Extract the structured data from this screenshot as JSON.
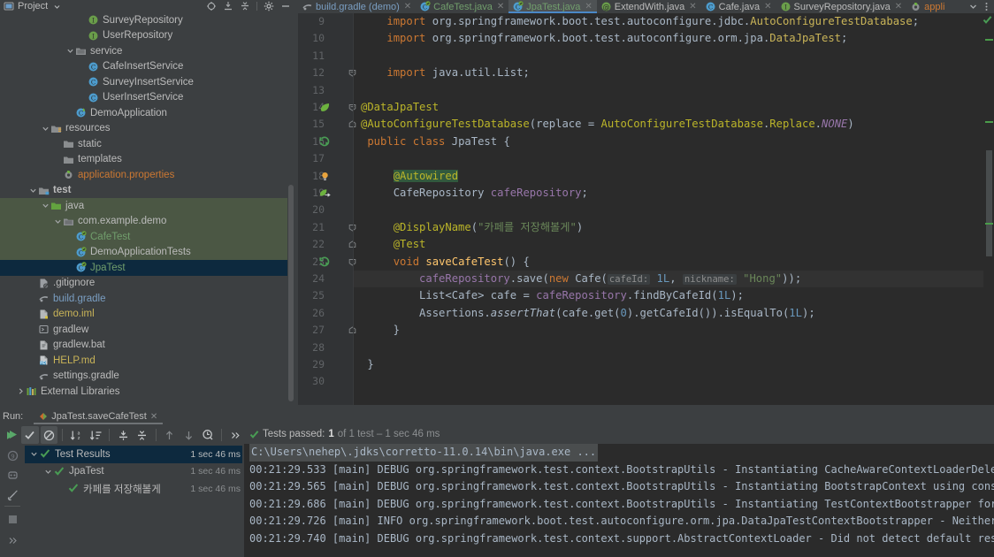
{
  "project_panel": {
    "title": "Project",
    "title_icon": "project-icon",
    "dropdown_icon": "chevron-down-icon",
    "toolbar": [
      {
        "name": "locate-icon",
        "label": ""
      },
      {
        "name": "expand-all-icon",
        "label": ""
      },
      {
        "name": "collapse-all-icon",
        "label": ""
      },
      {
        "name": "gear-icon",
        "label": ""
      },
      {
        "name": "hide-icon",
        "label": ""
      }
    ],
    "tree": [
      {
        "label": "SurveyRepository",
        "icon": "interface-icon",
        "indent": 6,
        "arrow": "",
        "color": "#bbbbbb",
        "section": "none"
      },
      {
        "label": "UserRepository",
        "icon": "interface-icon",
        "indent": 6,
        "arrow": "",
        "color": "#bbbbbb",
        "section": "none"
      },
      {
        "label": "service",
        "icon": "package-icon",
        "indent": 5,
        "arrow": "down",
        "color": "#bbbbbb",
        "section": "none"
      },
      {
        "label": "CafeInsertService",
        "icon": "class-icon",
        "indent": 6,
        "arrow": "",
        "color": "#bbbbbb",
        "section": "none"
      },
      {
        "label": "SurveyInsertService",
        "icon": "class-icon",
        "indent": 6,
        "arrow": "",
        "color": "#bbbbbb",
        "section": "none"
      },
      {
        "label": "UserInsertService",
        "icon": "class-icon",
        "indent": 6,
        "arrow": "",
        "color": "#bbbbbb",
        "section": "none"
      },
      {
        "label": "DemoApplication",
        "icon": "spring-class-icon",
        "indent": 5,
        "arrow": "",
        "color": "#bbbbbb",
        "section": "none"
      },
      {
        "label": "resources",
        "icon": "resources-root-icon",
        "indent": 3,
        "arrow": "down",
        "color": "#bbbbbb",
        "section": "none"
      },
      {
        "label": "static",
        "icon": "folder-icon",
        "indent": 4,
        "arrow": "",
        "color": "#bbbbbb",
        "section": "none"
      },
      {
        "label": "templates",
        "icon": "folder-icon",
        "indent": 4,
        "arrow": "",
        "color": "#bbbbbb",
        "section": "none"
      },
      {
        "label": "application.properties",
        "icon": "spring-properties-icon",
        "indent": 4,
        "arrow": "",
        "color": "#cc7832",
        "section": "none"
      },
      {
        "label": "test",
        "icon": "test-root-icon",
        "indent": 2,
        "arrow": "down",
        "color": "#bbbbbb",
        "bold": true,
        "section": "none"
      },
      {
        "label": "java",
        "icon": "test-source-icon",
        "indent": 3,
        "arrow": "down",
        "color": "#bbbbbb",
        "section": "test"
      },
      {
        "label": "com.example.demo",
        "icon": "package-icon",
        "indent": 4,
        "arrow": "down",
        "color": "#bbbbbb",
        "section": "test"
      },
      {
        "label": "CafeTest",
        "icon": "test-class-icon",
        "indent": 5,
        "arrow": "",
        "color": "#719e6c",
        "section": "test"
      },
      {
        "label": "DemoApplicationTests",
        "icon": "test-class-icon",
        "indent": 5,
        "arrow": "",
        "color": "#bbbbbb",
        "section": "test"
      },
      {
        "label": "JpaTest",
        "icon": "test-class-icon",
        "indent": 5,
        "arrow": "",
        "color": "#719e6c",
        "section": "selected"
      },
      {
        "label": ".gitignore",
        "icon": "gitignore-icon",
        "indent": 2,
        "arrow": "",
        "color": "#bbbbbb",
        "section": "none"
      },
      {
        "label": "build.gradle",
        "icon": "gradle-icon",
        "indent": 2,
        "arrow": "",
        "color": "#7a9ec2",
        "section": "none"
      },
      {
        "label": "demo.iml",
        "icon": "iml-icon",
        "indent": 2,
        "arrow": "",
        "color": "#c9b458",
        "section": "none"
      },
      {
        "label": "gradlew",
        "icon": "script-icon",
        "indent": 2,
        "arrow": "",
        "color": "#bbbbbb",
        "section": "none"
      },
      {
        "label": "gradlew.bat",
        "icon": "bat-icon",
        "indent": 2,
        "arrow": "",
        "color": "#bbbbbb",
        "section": "none"
      },
      {
        "label": "HELP.md",
        "icon": "markdown-icon",
        "indent": 2,
        "arrow": "",
        "color": "#c9b458",
        "section": "none"
      },
      {
        "label": "settings.gradle",
        "icon": "gradle-icon",
        "indent": 2,
        "arrow": "",
        "color": "#bbbbbb",
        "section": "none"
      },
      {
        "label": "External Libraries",
        "icon": "libraries-icon",
        "indent": 1,
        "arrow": "right",
        "color": "#bbbbbb",
        "section": "none"
      }
    ]
  },
  "editor": {
    "tabs": [
      {
        "label": "build.gradle (demo)",
        "icon": "gradle-icon",
        "active": false,
        "color": "#7a9ec2",
        "closable": true
      },
      {
        "label": "CafeTest.java",
        "icon": "test-class-icon",
        "active": false,
        "color": "#719e6c",
        "closable": true
      },
      {
        "label": "JpaTest.java",
        "icon": "test-class-icon",
        "active": true,
        "color": "#719e6c",
        "closable": true
      },
      {
        "label": "ExtendWith.java",
        "icon": "annotation-icon",
        "active": false,
        "color": "#bbbbbb",
        "closable": true
      },
      {
        "label": "Cafe.java",
        "icon": "class-icon",
        "active": false,
        "color": "#bbbbbb",
        "closable": true
      },
      {
        "label": "SurveyRepository.java",
        "icon": "interface-icon",
        "active": false,
        "color": "#bbbbbb",
        "closable": true
      },
      {
        "label": "appli",
        "icon": "spring-properties-icon",
        "active": false,
        "color": "#cc7832",
        "closable": false
      }
    ],
    "tabbar_right": [
      {
        "name": "tab-list-chevron-icon"
      },
      {
        "name": "more-options-icon"
      }
    ],
    "first_line_number": 9,
    "last_line_number": 30,
    "caret_line": 24,
    "status_ok_icon": "inspection-ok-icon",
    "lines": [
      {
        "n": 9,
        "gutter": "",
        "fold": "",
        "html": "    <span class=\"kw\">import</span> org.springframework.boot.test.autoconfigure.jdbc.<span style=\"color:#c9b458\">AutoConfigureTestDatabase</span>;"
      },
      {
        "n": 10,
        "gutter": "",
        "fold": "",
        "html": "    <span class=\"kw\">import</span> org.springframework.boot.test.autoconfigure.orm.jpa.<span style=\"color:#c9b458\">DataJpaTest</span>;"
      },
      {
        "n": 11,
        "gutter": "",
        "fold": "",
        "html": ""
      },
      {
        "n": 12,
        "gutter": "",
        "fold": "collapse",
        "html": "    <span class=\"kw\">import</span> java.util.List;"
      },
      {
        "n": 13,
        "gutter": "",
        "fold": "",
        "html": ""
      },
      {
        "n": 14,
        "gutter": "spring-leaf-icon",
        "fold": "collapse",
        "html": "<span class=\"ann\">@DataJpaTest</span>"
      },
      {
        "n": 15,
        "gutter": "",
        "fold": "fold-mid",
        "html": "<span class=\"ann\">@AutoConfigureTestDatabase</span>(<span class=\"typ\">replace</span> = <span class=\"ann\">AutoConfigureTestDatabase</span>.<span class=\"ann\">Replace</span>.<span class=\"cst\">NONE</span>)"
      },
      {
        "n": 16,
        "gutter": "run-test-icon",
        "fold": "",
        "html": " <span class=\"kw\">public class</span> <span class=\"typ\">JpaTest</span> {"
      },
      {
        "n": 17,
        "gutter": "",
        "fold": "",
        "html": ""
      },
      {
        "n": 18,
        "gutter": "bulb-icon",
        "fold": "",
        "html": "     <span class=\"ann hl-green\">@Autowired</span>"
      },
      {
        "n": 19,
        "gutter": "spring-bean-icon",
        "fold": "",
        "html": "     <span class=\"typ\">CafeRepository</span> <span class=\"fld\">cafeRepository</span>;"
      },
      {
        "n": 20,
        "gutter": "",
        "fold": "",
        "html": ""
      },
      {
        "n": 21,
        "gutter": "",
        "fold": "fold-top",
        "html": "     <span class=\"ann\">@DisplayName</span>(<span class=\"str\">\"카페를 저장해볼게\"</span>)"
      },
      {
        "n": 22,
        "gutter": "",
        "fold": "fold-mid",
        "html": "     <span class=\"ann\">@Test</span>"
      },
      {
        "n": 23,
        "gutter": "run-test-icon",
        "fold": "fold-top",
        "html": "     <span class=\"kw\">void</span> <span class=\"mth\">saveCafeTest</span>() {"
      },
      {
        "n": 24,
        "gutter": "",
        "fold": "",
        "html": "         <span class=\"fld\">cafeRepository</span>.<span style=\"color:#a9b7c6\">save</span>(<span class=\"kw\">new</span> <span class=\"typ\">Cafe</span>(<span class=\"hint\">cafeId:</span> <span class=\"num\">1L</span>, <span class=\"hint\">nickname:</span> <span class=\"str\">\"Hong\"</span>));"
      },
      {
        "n": 25,
        "gutter": "",
        "fold": "",
        "html": "         <span class=\"typ\">List&lt;Cafe&gt;</span> cafe = <span class=\"fld\">cafeRepository</span>.<span style=\"color:#a9b7c6\">findByCafeId</span>(<span class=\"num\">1L</span>);"
      },
      {
        "n": 26,
        "gutter": "",
        "fold": "",
        "html": "         <span class=\"typ\">Assertions</span>.<span class=\"stat\">assertThat</span>(cafe.get(<span class=\"num\">0</span>).getCafeId()).isEqualTo(<span class=\"num\">1L</span>);"
      },
      {
        "n": 27,
        "gutter": "",
        "fold": "fold-mid",
        "html": "     }"
      },
      {
        "n": 28,
        "gutter": "",
        "fold": "",
        "html": ""
      },
      {
        "n": 29,
        "gutter": "",
        "fold": "",
        "html": " }"
      },
      {
        "n": 30,
        "gutter": "",
        "fold": "",
        "html": ""
      }
    ]
  },
  "run_panel": {
    "run_label": "Run:",
    "run_tab_label": "JpaTest.saveCafeTest",
    "run_tab_icon": "run-config-icon",
    "toolbar": [
      {
        "name": "rerun-icon",
        "active": false
      },
      {
        "name": "show-passed-icon",
        "active": true
      },
      {
        "name": "show-ignored-icon",
        "active": true
      },
      {
        "name": "sort-alphabetically-icon",
        "active": false
      },
      {
        "name": "sort-by-duration-icon",
        "active": false
      },
      {
        "name": "expand-all-icon",
        "active": false
      },
      {
        "name": "collapse-all-icon",
        "active": false
      },
      {
        "name": "prev-failed-icon",
        "active": false
      },
      {
        "name": "next-failed-icon",
        "active": false
      },
      {
        "name": "history-icon",
        "active": false
      },
      {
        "name": "more-icon",
        "active": false
      }
    ],
    "left_gutter_icons": [
      "run-icon",
      "debug-icon",
      "profiler-icon",
      "build-icon",
      "terminal-icon",
      "more-tools-icon"
    ],
    "results": [
      {
        "label": "Test Results",
        "duration": "1 sec 46 ms",
        "indent": 0,
        "arrow": "down",
        "status": "passed",
        "selected": true
      },
      {
        "label": "JpaTest",
        "duration": "1 sec 46 ms",
        "indent": 1,
        "arrow": "down",
        "status": "passed",
        "selected": false
      },
      {
        "label": "카페를 저장해볼게",
        "duration": "1 sec 46 ms",
        "indent": 2,
        "arrow": "",
        "status": "passed",
        "selected": false
      }
    ],
    "console": {
      "status_icon": "passed-check-icon",
      "status_prefix": "Tests passed:",
      "status_count": "1",
      "status_suffix": "of 1 test – 1 sec 46 ms",
      "command": "C:\\Users\\nehep\\.jdks\\corretto-11.0.14\\bin\\java.exe ...",
      "log_lines": [
        "00:21:29.533 [main] DEBUG org.springframework.test.context.BootstrapUtils - Instantiating CacheAwareContextLoaderDelegat",
        "00:21:29.565 [main] DEBUG org.springframework.test.context.BootstrapUtils - Instantiating BootstrapContext using constru",
        "00:21:29.686 [main] DEBUG org.springframework.test.context.BootstrapUtils - Instantiating TestContextBootstrapper for te",
        "00:21:29.726 [main] INFO org.springframework.boot.test.autoconfigure.orm.jpa.DataJpaTestContextBootstrapper - Neither @C",
        "00:21:29.740 [main] DEBUG org.springframework.test.context.support.AbstractContextLoader - Did not detect default resour"
      ]
    }
  },
  "colors": {
    "panel_bg": "#3c3f41",
    "editor_bg": "#2b2b2b",
    "gutter_bg": "#313335",
    "selection_blue": "#0d293e",
    "test_source_green": "#4b5744",
    "accent_blue": "#4a88c7",
    "pass_green": "#499c54"
  }
}
